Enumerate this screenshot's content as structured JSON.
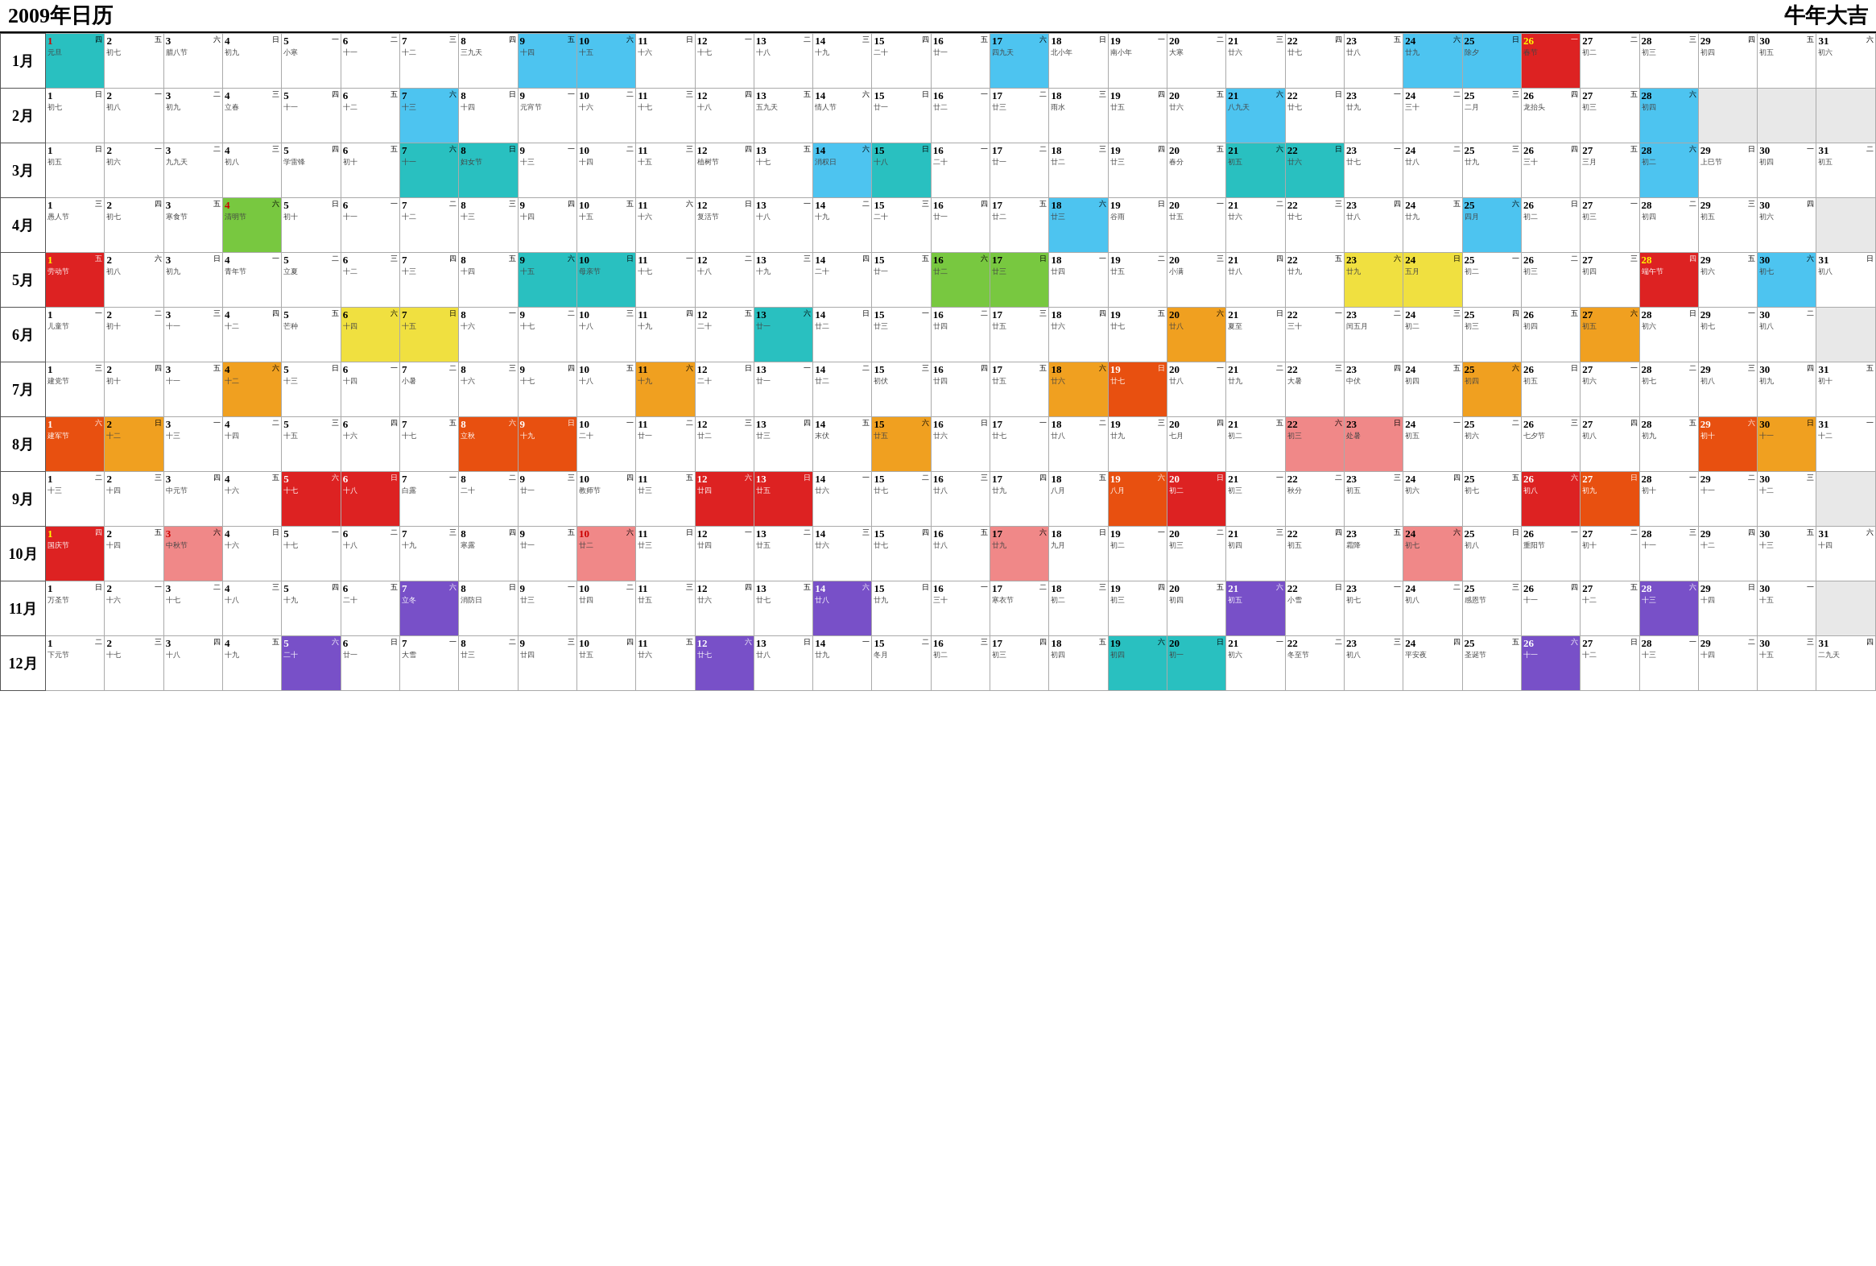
{
  "header": {
    "title_left": "2009年日历",
    "title_right": "牛年大吉"
  },
  "months": [
    {
      "label": "1月"
    },
    {
      "label": "2月"
    },
    {
      "label": "3月"
    },
    {
      "label": "4月"
    },
    {
      "label": "5月"
    },
    {
      "label": "6月"
    },
    {
      "label": "7月"
    },
    {
      "label": "8月"
    },
    {
      "label": "9月"
    },
    {
      "label": "10月"
    },
    {
      "label": "11月"
    },
    {
      "label": "12月"
    }
  ]
}
